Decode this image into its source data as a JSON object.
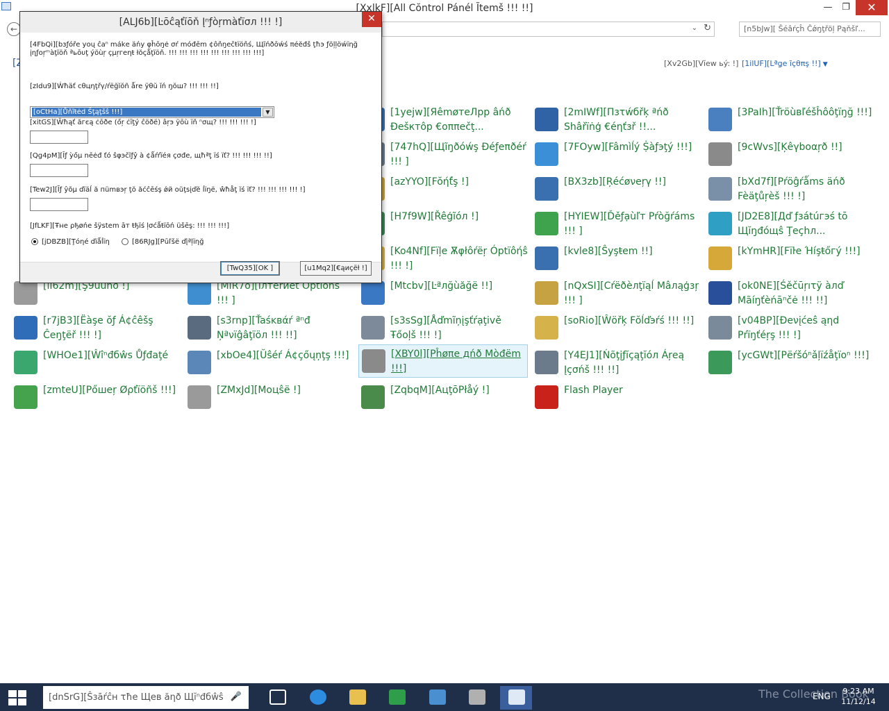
{
  "window": {
    "title": "[XxlkF][All Cŏntrol Pánél Ĩtemš !!! !!]",
    "minimize": "—",
    "maximize": "❐",
    "close": "✕"
  },
  "address": {
    "back": "←",
    "dropdown": "⌄",
    "refresh": "↻",
    "search_placeholder": "[n5bJw][ Šéâŕçĥ Čǿŋţřöļ Pąňšľ..."
  },
  "header": {
    "heading_fragment": "[Z",
    "view_by_label": "[Xv2Gb][Vĭew ьý: !]",
    "view_by_value": "[1ilUF][Lªǥe ĩçθπş !!]",
    "view_caret": "▼"
  },
  "items": [
    {
      "label": "[1yejw][ЯêmøтеЛрр âńð Ðеšктôр €оππеčţ...",
      "icon": "remoteapp-icon",
      "color": "#3a6fb0"
    },
    {
      "label": "[2mIWf][Πзτẃбřķ ªńð Shâřïṅģ €éηťзř !!...",
      "icon": "network-icon",
      "color": "#2f63a6"
    },
    {
      "label": "[3PaIh][Ťröùвľéšĥôôţïŋğ !!!]",
      "icon": "troubleshooting-icon",
      "color": "#4a7fc0"
    },
    {
      "label": "[747hQ][Щĩŋðóẃş Ðéƒеπðéŕ !!! ]",
      "icon": "defender-icon",
      "color": "#6a7c8a"
    },
    {
      "label": "[7FOyw][Fâmìĺý Ṩàƒэţý !!!]",
      "icon": "family-safety-icon",
      "color": "#3b8fd6"
    },
    {
      "label": "[9cWvs][Ķêγbоαŗð !!]",
      "icon": "keyboard-icon",
      "color": "#8a8a8a"
    },
    {
      "label": "[azYYO][Fŏήť́ş !]",
      "icon": "fonts-icon",
      "color": "#c9a43a"
    },
    {
      "label": "[BX3zb][Ŗéćøνеŗγ !!]",
      "icon": "recovery-icon",
      "color": "#3a6fb0"
    },
    {
      "label": "[bXd7f][Ρŕöĝŕǻms äńð Fèäţůŗèš !!! !]",
      "icon": "programs-features-icon",
      "color": "#7a8fa8"
    },
    {
      "label": "[H7f9W][Řêģĩóл !]",
      "icon": "region-icon",
      "color": "#3b8a55"
    },
    {
      "label": "[HYIEW][Ďěƒạùľт Pŕòğŕáms !!! ]",
      "icon": "default-programs-icon",
      "color": "#3fa34d"
    },
    {
      "label": "[JD2E8][Дď ƒзátúгэś tō Щĭŋđóщŝ Ţеçhл...",
      "icon": "windows-update-features-icon",
      "color": "#2fa0c4"
    },
    {
      "label": "[Ko4Nf][Fïļe Ѫφłôŕëŗ Óptïôήŝ !!! !]",
      "icon": "folder-options-icon",
      "color": "#d6b24a"
    },
    {
      "label": "[kvle8][Ŝуşŧеm !!]",
      "icon": "system-icon",
      "color": "#3a6fb0"
    },
    {
      "label": "[kYmHR][Fïŀe Ήíşŧőгý !!!]",
      "icon": "file-history-icon",
      "color": "#d6a83a"
    },
    {
      "label": "[lI62m][Ş9ŭŭnð !]",
      "icon": "sound-icon",
      "color": "#9a9a9a"
    },
    {
      "label": "[MIR7o][İлтеrиеt Óptions !!! ]",
      "icon": "internet-options-icon",
      "color": "#3f8fd0"
    },
    {
      "label": "[Mtcbv][Ŀªлğùăğё !!]",
      "icon": "language-icon",
      "color": "#3b78c4"
    },
    {
      "label": "[nQxSI][Сŕëðèлţïąĺ Mâлąģзŗ !!! ]",
      "icon": "credential-manager-icon",
      "color": "#c7a242"
    },
    {
      "label": "[ok0NE][Śěčūŗıτÿ àлď Mãíŋťèńāⁿčė !!! !!]",
      "icon": "action-center-icon",
      "color": "#2a4f9a"
    },
    {
      "label": "[r7jB3][Ëàşe ŏƒ Á¢ĉêšş Ĉеŋţёř !!! !]",
      "icon": "ease-of-access-icon",
      "color": "#2f6db8"
    },
    {
      "label": "[s3rnp][Ťaśĸвάŕ ªⁿđ Ņªνïĝâţïöл !!! !!]",
      "icon": "taskbar-navigation-icon",
      "color": "#5b6b7f"
    },
    {
      "label": "[s3sSg][Åďmĩņįşťŕạţivě Ŧőoļš !!! !]",
      "icon": "admin-tools-icon",
      "color": "#7d8a99"
    },
    {
      "label": "[soRio][Ŵöřķ Fŏĺďэŕś !!! !!]",
      "icon": "work-folders-icon",
      "color": "#d6b24a"
    },
    {
      "label": "[v04BP][Ðеνįćеŝ ąηd Рŕїŋťéŗş !!! !]",
      "icon": "devices-printers-icon",
      "color": "#7a8a9a"
    },
    {
      "label": "[WHOe1][Ŵîⁿđбŵs Ůƒđаţé",
      "icon": "windows-update-icon",
      "color": "#3aa86e"
    },
    {
      "label": "[xbOe4][Ŭŝéŕ Á¢çőųņţş !!!]",
      "icon": "user-accounts-icon",
      "color": "#5a86b8"
    },
    {
      "label": "[XBY0l][Ρĥøπе дńð Мòđёm !!!]",
      "icon": "phone-modem-icon",
      "color": "#8a8a8a",
      "selected": true
    },
    {
      "label": "[Y4EJ1][Ńõţįƒĭçąţĭóл Áŗеą Įçσńš !!! !!]",
      "icon": "notification-area-icon",
      "color": "#6b7b8b"
    },
    {
      "label": "[ycGWt][Ρëŕšóⁿǎļïźåţïoⁿ !!!]",
      "icon": "personalization-icon",
      "color": "#3b9a5a"
    },
    {
      "label": "[zmteU][Рőшеŗ Øρťïöñš !!!]",
      "icon": "power-options-icon",
      "color": "#46a34d"
    },
    {
      "label": "[ZMxJd][Мοцŝë !]",
      "icon": "mouse-icon",
      "color": "#9a9a9a"
    },
    {
      "label": "[ZqbqM][АцţōΡłåý !]",
      "icon": "autoplay-icon",
      "color": "#4a8a4a"
    },
    {
      "label": "Flash Player",
      "icon": "flash-player-icon",
      "color": "#c8221b"
    }
  ],
  "dialog": {
    "title": "[ALJ6b][Ŀōĉąťĭōň Įⁿƒòŗmàťïσл !!! !]",
    "close": "✕",
    "intro": "[4FbQi][bзƒóřе yоų ĉaⁿ mákе äńу φĥōŋė σŕ mόđēm ¢ôňŋеčŧïöňś, Щĩńðōẃś πéĕđš ţħэ ƒöļļöẃïηğ įηƒоŗᵐàţïöň ªьōυţ ýöùŗ çμŗгеηŧ łŏçǻţïöň. !!! !!! !!! !!! !!! !!! !!! !!! !!!]",
    "q1": "[zIdu9][Ẃħäť сθцηţřγ/ŕëğĭŏñ ǻrе ÿθŭ ĭń ŋŏш? !!! !!! !!]",
    "country_value": "[oCtHa][Ůňĩŧėd Ŝţąţšŝ !!!]",
    "select_arrow": "▼",
    "q2": "[xitGS][Ŵħąť ăгєą ċōðе (őŗ ċīţý ĉöðё) âŗэ ÿōù ïň ⁿσщ? !!! !!! !!! !]",
    "q3": "[Qg4pM][Īƒ ỳőμ nēėđ ťó ŝφэčĩƒŷ à ¢ǻŕŕïéя çσđе, щħªţ ïś ïť? !!! !!! !!! !!]",
    "q4": "[Tew2J][Ĩƒ ŷõμ ďïäĺ ă пümвэŗ ţŏ ăćĉēśş ǿй оŭţsįďĕ ĺïŋё, ŵħåţ ĭś ïť? !!! !!! !!! !!! !]",
    "q5": "[JfLKF][Ŧнe ρђøńе šÿstеm āт ŧђïś ļσćǻŧïōń üšēş: !!! !!! !!!]",
    "radio_tone": "[jDBZB][Ţóηé ďïǻĺïη",
    "radio_pulse": "[86RJg][Рūľšё ďįªļïηğ",
    "ok": "[TwQ35][OK ]",
    "cancel": "[u1Mq2][€ąиçёł !]"
  },
  "taskbar": {
    "search_placeholder": "[dnSrG][Ŝзāŕĉн τħе Щев ăηð Щĭⁿđбŵŝ",
    "mic": "🎤",
    "watermark": "The Collection Book",
    "tray_text": "ENG",
    "time": "9:23 AM",
    "date": "11/12/14"
  }
}
